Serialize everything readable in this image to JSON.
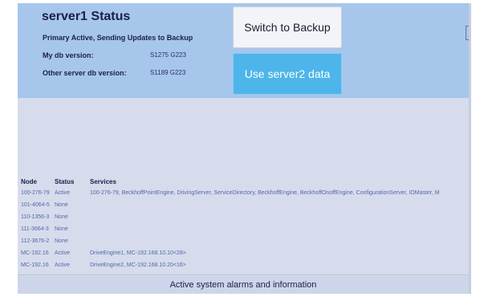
{
  "status": {
    "title": "server1 Status",
    "subtitle": "Primary Active, Sending Updates to Backup",
    "my_db_label": "My db version:",
    "my_db_value": "S1275 G223",
    "other_db_label": "Other server db version:",
    "other_db_value": "S1189 G223"
  },
  "buttons": {
    "switch": "Switch to Backup",
    "use_server2": "Use server2 data"
  },
  "table": {
    "headers": {
      "node": "Node",
      "status": "Status",
      "services": "Services"
    },
    "rows": [
      {
        "node": "100-276-79",
        "status": "Active",
        "services": "100-276-79, BeckhoffPointEngine, DrivingServer, ServiceDirectory, BeckhoffEngine, BeckhoffOnoffEngine, ConfigurationServer, IOMaster, M"
      },
      {
        "node": "101-4064-5",
        "status": "None",
        "services": ""
      },
      {
        "node": "110-1356-3",
        "status": "None",
        "services": ""
      },
      {
        "node": "111-3664-3",
        "status": "None",
        "services": ""
      },
      {
        "node": "112-3676-2",
        "status": "None",
        "services": ""
      },
      {
        "node": "MC-192.16",
        "status": "Active",
        "services": "DriveEngine1, MC-192.168.10.10<28>"
      },
      {
        "node": "MC-192.16",
        "status": "Active",
        "services": "DriveEngine2, MC-192.168.10.20<16>"
      }
    ]
  },
  "alarms": {
    "title": "Active system alarms and information"
  },
  "colors": {
    "header_bg": "#a6c6ec",
    "use_button": "#4db5ea",
    "switch_button": "#f2f4f8"
  }
}
